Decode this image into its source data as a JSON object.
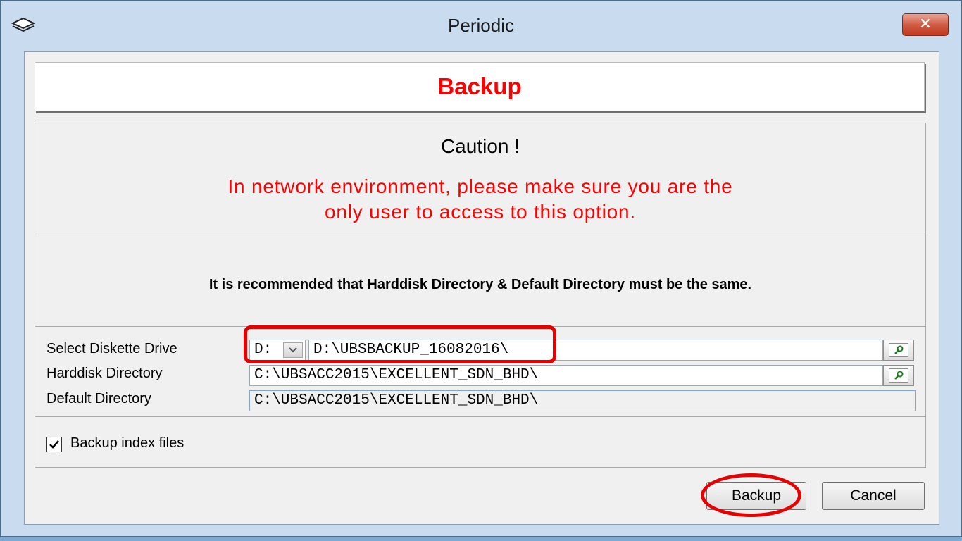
{
  "window": {
    "title": "Periodic",
    "close_glyph": "✕",
    "icon": "diskette-stack-icon"
  },
  "header": {
    "title": "Backup",
    "color": "#ff0000"
  },
  "caution": {
    "title": "Caution !",
    "line1": "In network environment, please make sure you are the",
    "line2": "only user to access to this option."
  },
  "recommendation": "It is recommended that Harddisk Directory & Default Directory must be the same.",
  "fields": {
    "diskette_label": "Select Diskette Drive",
    "diskette_drive": "D:",
    "diskette_path": "D:\\UBSBACKUP_16082016\\",
    "harddisk_label": "Harddisk Directory",
    "harddisk_path": "C:\\UBSACC2015\\EXCELLENT_SDN_BHD\\",
    "default_label": "Default Directory",
    "default_path": "C:\\UBSACC2015\\EXCELLENT_SDN_BHD\\"
  },
  "options": {
    "backup_index_label": "Backup index files",
    "backup_index_checked": true
  },
  "buttons": {
    "backup_label": "Backup",
    "cancel_label": "Cancel"
  },
  "annotation_color": "#e80000"
}
